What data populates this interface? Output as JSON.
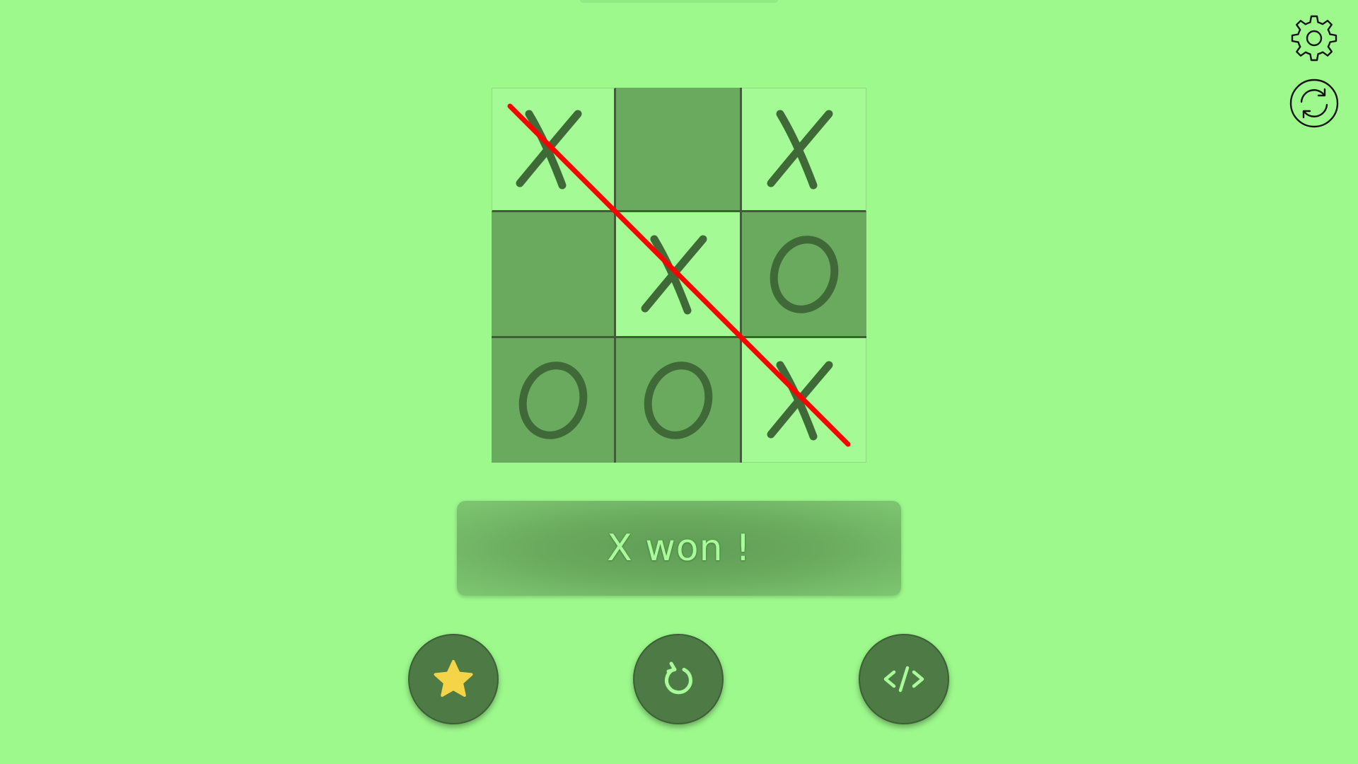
{
  "status": {
    "message": "X won !"
  },
  "board": {
    "cells": [
      "X",
      "",
      "X",
      "",
      "X",
      "O",
      "O",
      "O",
      "X"
    ],
    "shading": [
      "light",
      "dark",
      "light",
      "dark",
      "light",
      "dark",
      "dark",
      "dark",
      "light"
    ],
    "winning_line": [
      0,
      4,
      8
    ]
  },
  "colors": {
    "background": "#9ef98d",
    "cell_light": "#a4fb95",
    "cell_dark": "#6aaa5e",
    "mark": "#3f6a38",
    "win_line": "#ff0000",
    "button": "#4e7a46",
    "star": "#f5d547"
  },
  "icons": {
    "settings": "gear-icon",
    "sync": "sync-icon",
    "star": "star-icon",
    "restart": "restart-icon",
    "code": "code-icon"
  }
}
